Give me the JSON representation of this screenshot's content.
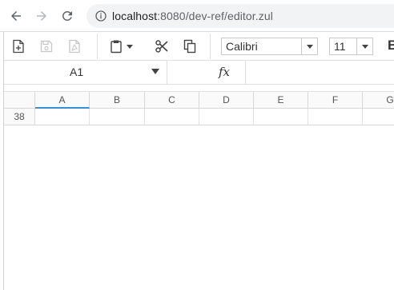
{
  "browser": {
    "url_host": "localhost",
    "url_rest": ":8080/dev-ref/editor.zul"
  },
  "toolbar": {
    "font_name": "Calibri",
    "font_size": "11",
    "bold_label": "B"
  },
  "formula_bar": {
    "cell_reference": "A1",
    "fx_label": "fx"
  },
  "grid": {
    "columns": [
      "A",
      "B",
      "C",
      "D",
      "E",
      "F",
      "G"
    ],
    "selected_column": "A",
    "rows": [
      "38"
    ]
  },
  "colors": {
    "selection_accent": "#3d8ec9"
  }
}
